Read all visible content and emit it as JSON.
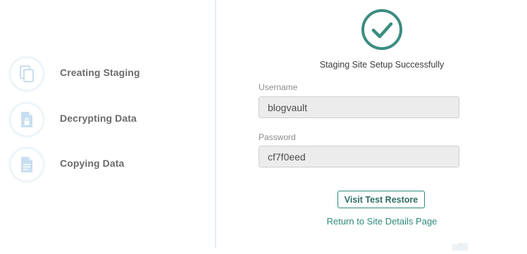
{
  "steps": [
    {
      "label": "Creating Staging",
      "icon": "copy-icon"
    },
    {
      "label": "Decrypting Data",
      "icon": "lock-file-icon"
    },
    {
      "label": "Copying Data",
      "icon": "document-icon"
    }
  ],
  "result": {
    "status_icon": "check-circle-icon",
    "title": "Staging Site Setup Successfully",
    "username_label": "Username",
    "username_value": "blogvault",
    "password_label": "Password",
    "password_value": "cf7f0eed",
    "visit_button": "Visit Test Restore",
    "return_link": "Return to Site Details Page"
  },
  "colors": {
    "accent": "#2e8a7a",
    "check": "#3a8d80",
    "icon": "#c9def0",
    "divider": "#e4eef6",
    "field_bg": "#ececec"
  }
}
